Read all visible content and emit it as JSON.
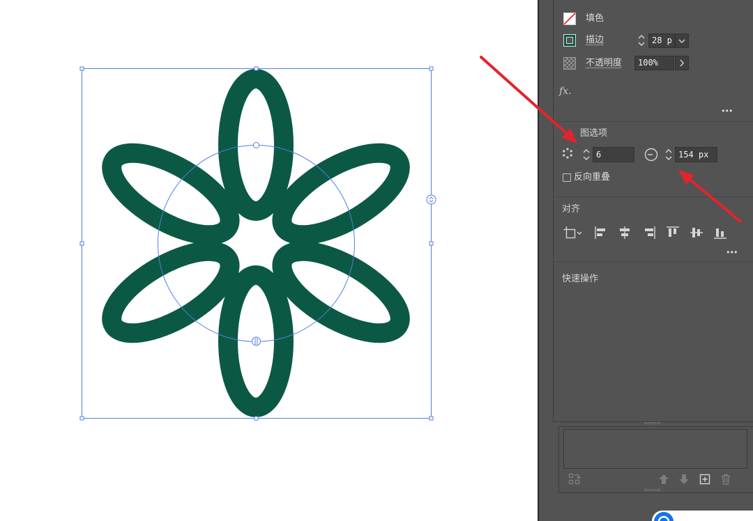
{
  "appearance": {
    "fill_label": "填色",
    "stroke_label": "描边",
    "stroke_weight": "28 p",
    "opacity_label": "不透明度",
    "opacity_value": "100%",
    "fx_label": "fx.",
    "more_label": "•••"
  },
  "radial_repeat": {
    "title": "图选项",
    "instances": "6",
    "radius": "154 px",
    "reverse_overlap": {
      "label": "反向重叠",
      "checked": false
    }
  },
  "align": {
    "title": "对齐",
    "more_label": "•••"
  },
  "quick_actions": {
    "title": "快速操作"
  },
  "icons": {
    "fill": "fill-none-swatch-icon",
    "stroke": "stroke-swatch-icon",
    "opacity": "opacity-checker-icon",
    "instances": "radial-instances-icon",
    "radius": "radial-radius-icon",
    "align": [
      "align-to-selection-icon",
      "align-left-icon",
      "align-horizontal-center-icon",
      "align-right-icon",
      "align-top-icon",
      "align-vertical-center-icon",
      "align-bottom-icon"
    ],
    "artboards_footer": [
      "rearrange-artboards-icon",
      "move-up-icon",
      "move-down-icon",
      "new-artboard-icon",
      "delete-artboard-icon"
    ],
    "help": "help-icon"
  },
  "colors": {
    "artwork_stroke": "#0b5944",
    "selection": "#4f7fe0",
    "annotation_arrow": "#e4232b",
    "panel_background": "#535353",
    "canvas_background": "#ffffff"
  }
}
